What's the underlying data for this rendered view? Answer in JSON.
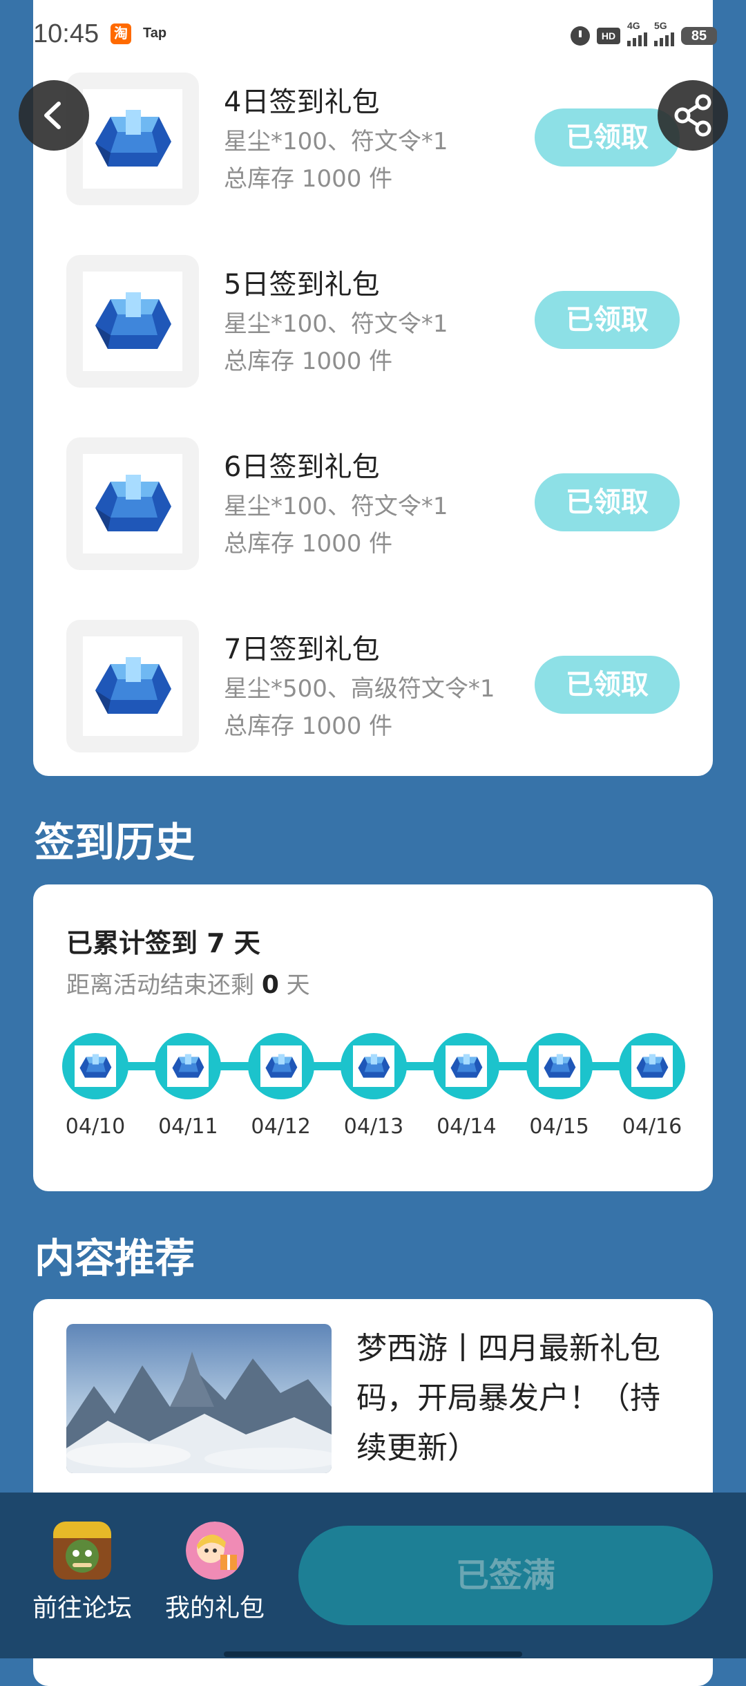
{
  "status_bar": {
    "time": "10:45",
    "app_icon_text": "淘",
    "tap_label": "Tap",
    "hd_label": "HD",
    "net_4g": "4G",
    "net_5g": "5G",
    "battery": "85"
  },
  "gifts": [
    {
      "title": "4日签到礼包",
      "items": "星尘*100、符文令*1",
      "stock": "总库存 1000 件",
      "button": "已领取"
    },
    {
      "title": "5日签到礼包",
      "items": "星尘*100、符文令*1",
      "stock": "总库存 1000 件",
      "button": "已领取"
    },
    {
      "title": "6日签到礼包",
      "items": "星尘*100、符文令*1",
      "stock": "总库存 1000 件",
      "button": "已领取"
    },
    {
      "title": "7日签到礼包",
      "items": "星尘*500、高级符文令*1",
      "stock": "总库存 1000 件",
      "button": "已领取"
    }
  ],
  "history": {
    "section_title": "签到历史",
    "count_text": "已累计签到 7 天",
    "remain_prefix": "距离活动结束还剩 ",
    "remain_value": "0",
    "remain_suffix": " 天",
    "dates": [
      "04/10",
      "04/11",
      "04/12",
      "04/13",
      "04/14",
      "04/15",
      "04/16"
    ]
  },
  "recommend": {
    "section_title": "内容推荐",
    "article_title": "梦西游丨四月最新礼包码，开局暴发户！（持续更新）"
  },
  "bottom_bar": {
    "forum_label": "前往论坛",
    "gifts_label": "我的礼包",
    "signed_label": "已签满"
  },
  "colors": {
    "background": "#3773a9",
    "accent": "#1cc3cc",
    "claimed_button": "#8de0e6",
    "bottom_bar": "#1d476c"
  }
}
